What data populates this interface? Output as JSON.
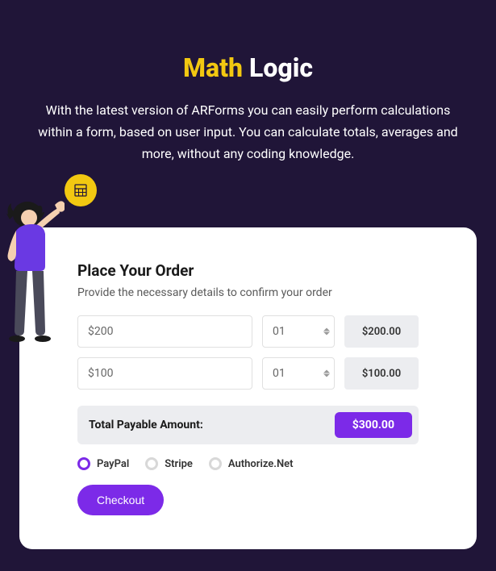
{
  "header": {
    "title_accent": "Math",
    "title_rest": " Logic",
    "subtitle": "With the latest version of ARForms you can easily perform calculations within a form, based on user input. You can calculate totals, averages and more, without any coding knowledge."
  },
  "form": {
    "title": "Place Your Order",
    "subtitle": "Provide the necessary details to confirm your order",
    "rows": [
      {
        "price": "$200",
        "qty": "01",
        "line_total": "$200.00"
      },
      {
        "price": "$100",
        "qty": "01",
        "line_total": "$100.00"
      }
    ],
    "total_label": "Total Payable Amount:",
    "total_value": "$300.00",
    "payment_options": [
      {
        "label": "PayPal",
        "selected": true
      },
      {
        "label": "Stripe",
        "selected": false
      },
      {
        "label": "Authorize.Net",
        "selected": false
      }
    ],
    "checkout_label": "Checkout"
  },
  "icons": {
    "badge": "calculator-icon"
  }
}
